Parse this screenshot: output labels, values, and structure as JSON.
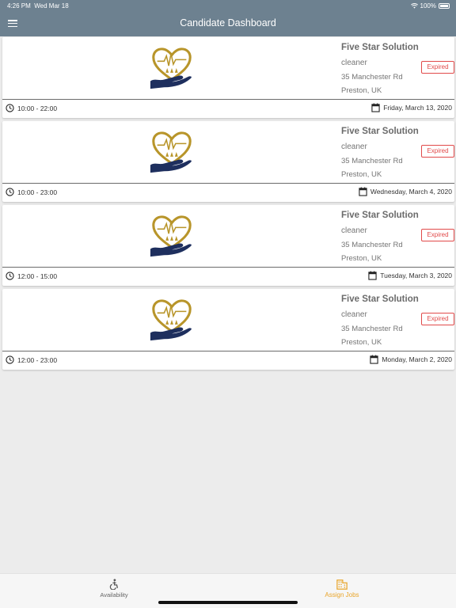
{
  "status_bar": {
    "time": "4:26 PM",
    "date": "Wed Mar 18",
    "battery": "100%"
  },
  "header": {
    "title": "Candidate Dashboard"
  },
  "jobs": [
    {
      "company": "Five Star Solution",
      "role": "cleaner",
      "address": "35 Manchester Rd",
      "city": "Preston, UK",
      "status": "Expired",
      "time": "10:00 - 22:00",
      "date": "Friday, March 13, 2020"
    },
    {
      "company": "Five Star Solution",
      "role": "cleaner",
      "address": "35 Manchester Rd",
      "city": "Preston, UK",
      "status": "Expired",
      "time": "10:00 - 23:00",
      "date": "Wednesday, March 4, 2020"
    },
    {
      "company": "Five Star Solution",
      "role": "cleaner",
      "address": "35 Manchester Rd",
      "city": "Preston, UK",
      "status": "Expired",
      "time": "12:00 - 15:00",
      "date": "Tuesday, March 3, 2020"
    },
    {
      "company": "Five Star Solution",
      "role": "cleaner",
      "address": "35 Manchester Rd",
      "city": "Preston, UK",
      "status": "Expired",
      "time": "12:00 - 23:00",
      "date": "Monday, March 2, 2020"
    }
  ],
  "tabs": [
    {
      "label": "Availability",
      "icon": "accessibility-icon",
      "active": false
    },
    {
      "label": "Assign Jobs",
      "icon": "building-icon",
      "active": true
    }
  ],
  "colors": {
    "header": "#6d8190",
    "accent": "#e9a52a",
    "expired": "#e14a4a",
    "logo_gold": "#b8952a",
    "logo_navy": "#1e2f5e"
  }
}
